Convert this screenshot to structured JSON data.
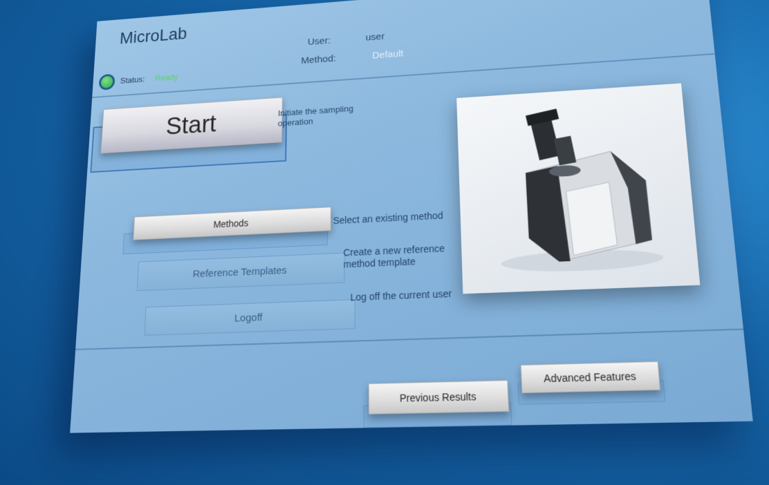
{
  "app": {
    "title": "MicroLab"
  },
  "header": {
    "user_label": "User:",
    "user_value": "user",
    "method_label": "Method:",
    "method_value": "Default",
    "status_label": "Status:",
    "status_value": "Ready"
  },
  "actions": {
    "start": {
      "label": "Start",
      "description": "Initiate the sampling operation"
    },
    "methods": {
      "label": "Methods",
      "description": "Select an existing method"
    },
    "reference_templates": {
      "label": "Reference Templates",
      "description": "Create a new reference method template"
    },
    "logoff": {
      "label": "Logoff",
      "description": "Log off the current user"
    }
  },
  "footer": {
    "previous_results": "Previous Results",
    "advanced_features": "Advanced Features"
  },
  "colors": {
    "status_ready": "#5fd06e",
    "panel": "#8cb8de",
    "background": "#1565a8"
  },
  "icons": {
    "status": "status-indicator-icon",
    "instrument": "spectrometer-image"
  }
}
